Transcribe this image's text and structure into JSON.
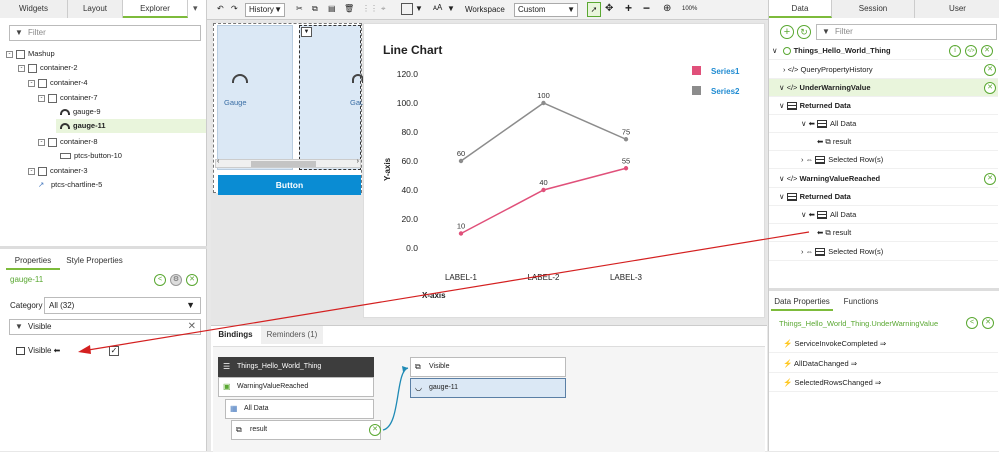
{
  "left": {
    "tabs": [
      "Widgets",
      "Layout",
      "Explorer"
    ],
    "filter_placeholder": "Filter",
    "tree": [
      "Mashup",
      "container-2",
      "container-4",
      "container-7",
      "gauge-9",
      "gauge-11",
      "container-8",
      "ptcs-button-10",
      "container-3",
      "ptcs-chartline-5"
    ],
    "props_tabs": [
      "Properties",
      "Style Properties"
    ],
    "selected_widget": "gauge-11",
    "category_label": "Category",
    "category_value": "All (32)",
    "prop_filter": "Visible",
    "prop_row_label": "Visible"
  },
  "toolbar": {
    "history": "History",
    "workspace_label": "Workspace",
    "workspace_value": "Custom",
    "zoom": "100%"
  },
  "canvas": {
    "gauge_label": "Gauge",
    "gauge_label2": "Gau",
    "button_label": "Button",
    "chart_title": "Line Chart",
    "xlabel": "X-axis",
    "ylabel": "Y-axis"
  },
  "chart_data": {
    "type": "line",
    "title": "Line Chart",
    "xlabel": "X-axis",
    "ylabel": "Y-axis",
    "categories": [
      "LABEL-1",
      "LABEL-2",
      "LABEL-3"
    ],
    "ylim": [
      0,
      120
    ],
    "yticks": [
      "0.0",
      "20.0",
      "40.0",
      "60.0",
      "80.0",
      "100.0",
      "120.0"
    ],
    "series": [
      {
        "name": "Series1",
        "values": [
          10,
          40,
          55
        ],
        "color": "#e0507a"
      },
      {
        "name": "Series2",
        "values": [
          60,
          100,
          75
        ],
        "color": "#8c8c8c"
      }
    ]
  },
  "bindings": {
    "tabs": [
      "Bindings",
      "Reminders (1)"
    ],
    "source": "Things_Hello_World_Thing",
    "service": "WarningValueReached",
    "alldata": "All Data",
    "result": "result",
    "target_visible": "Visible",
    "target_gauge": "gauge-11"
  },
  "right": {
    "tabs": [
      "Data",
      "Session",
      "User"
    ],
    "filter_placeholder": "Filter",
    "thing": "Things_Hello_World_Thing",
    "rows": [
      "QueryPropertyHistory",
      "UnderWarningValue",
      "Returned Data",
      "All Data",
      "result",
      "Selected Row(s)",
      "WarningValueReached",
      "Returned Data",
      "All Data",
      "result",
      "Selected Row(s)"
    ],
    "dp_tabs": [
      "Data Properties",
      "Functions"
    ],
    "dp_title": "Things_Hello_World_Thing.UnderWarningValue",
    "events": [
      "ServiceInvokeCompleted",
      "AllDataChanged",
      "SelectedRowsChanged"
    ]
  }
}
